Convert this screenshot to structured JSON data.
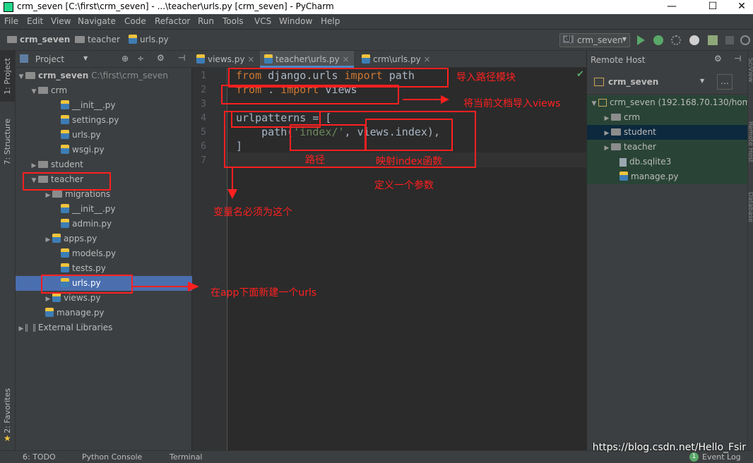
{
  "window": {
    "title": "crm_seven [C:\\first\\crm_seven] - ...\\teacher\\urls.py [crm_seven] - PyCharm",
    "minimize": "—",
    "maximize": "☐",
    "close": "✕"
  },
  "menu": [
    "File",
    "Edit",
    "View",
    "Navigate",
    "Code",
    "Refactor",
    "Run",
    "Tools",
    "VCS",
    "Window",
    "Help"
  ],
  "breadcrumb": [
    "crm_seven",
    "teacher",
    "urls.py"
  ],
  "run_config": {
    "badge": "dj",
    "label": "crm_seven"
  },
  "left_strip": {
    "project": "1: Project",
    "structure": "7: Structure",
    "favorites": "2: Favorites"
  },
  "project_panel": {
    "title": "Project",
    "tree": [
      {
        "label": "crm_seven",
        "extra": "C:\\first\\crm_seven"
      },
      {
        "label": "crm"
      },
      {
        "label": "__init__.py"
      },
      {
        "label": "settings.py"
      },
      {
        "label": "urls.py"
      },
      {
        "label": "wsgi.py"
      },
      {
        "label": "student"
      },
      {
        "label": "teacher"
      },
      {
        "label": "migrations"
      },
      {
        "label": "__init__.py"
      },
      {
        "label": "admin.py"
      },
      {
        "label": "apps.py"
      },
      {
        "label": "models.py"
      },
      {
        "label": "tests.py"
      },
      {
        "label": "urls.py"
      },
      {
        "label": "views.py"
      },
      {
        "label": "manage.py"
      },
      {
        "label": "External Libraries"
      }
    ]
  },
  "editor_tabs": [
    "views.py",
    "teacher\\urls.py",
    "crm\\urls.py"
  ],
  "code": {
    "line_numbers": [
      "1",
      "2",
      "3",
      "4",
      "5",
      "6",
      "7"
    ],
    "l1_kw1": "from",
    "l1_mod": " django.urls ",
    "l1_kw2": "import",
    "l1_name": " path",
    "l2_kw1": "from",
    "l2_mod": " . ",
    "l2_kw2": "import",
    "l2_name": " views",
    "l4": "urlpatterns = [",
    "l5_a": "    path(",
    "l5_str": "'index/'",
    "l5_b": ", views.index),",
    "l6": "]"
  },
  "remote_host": {
    "title": "Remote Host",
    "server": "crm_seven",
    "tree": [
      {
        "label": "crm_seven (192.168.70.130/hom"
      },
      {
        "label": "crm"
      },
      {
        "label": "student"
      },
      {
        "label": "teacher"
      },
      {
        "label": "db.sqlite3"
      },
      {
        "label": "manage.py"
      }
    ]
  },
  "right_strip": {
    "scview": "SciView",
    "remote": "Remote Host",
    "database": "Database"
  },
  "status": {
    "todo": "6: TODO",
    "console": "Python Console",
    "terminal": "Terminal",
    "events_count": "1",
    "event_log": "Event Log"
  },
  "annotations": {
    "import_path": "导入路径模块",
    "import_views": "将当前文档导入views",
    "path_label": "路径",
    "map_index": "映射index函数",
    "define_param": "定义一个参数",
    "var_name": "变量名必须为这个",
    "new_urls": "在app下面新建一个urls"
  },
  "watermark": "https://blog.csdn.net/Hello_Fsir",
  "colors": {
    "annotation": "#ff2020",
    "selection": "#4b6eaf",
    "remote_green": "#294436"
  }
}
